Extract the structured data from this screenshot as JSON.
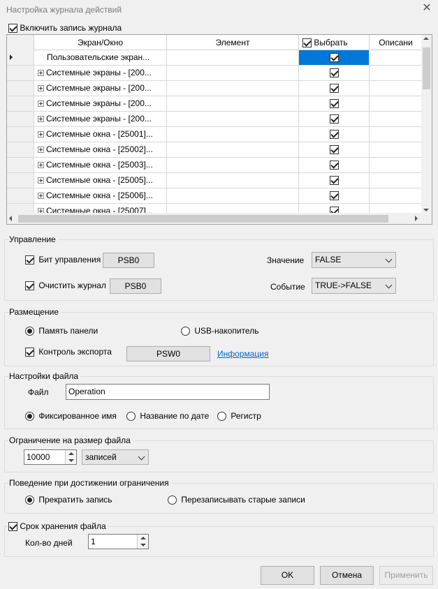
{
  "window": {
    "title": "Настройка журнала действий"
  },
  "enable_logging": {
    "label": "Включить запись журнала",
    "checked": true
  },
  "grid": {
    "columns": [
      "Экран/Окно",
      "Элемент",
      "Выбрать",
      "Описани"
    ],
    "rows": [
      {
        "name": "Пользовательские экран...",
        "expandable": false,
        "selected": true,
        "current": true
      },
      {
        "name": "Системные экраны - [200...",
        "expandable": true,
        "selected": true
      },
      {
        "name": "Системные экраны - [200...",
        "expandable": true,
        "selected": true
      },
      {
        "name": "Системные экраны - [200...",
        "expandable": true,
        "selected": true
      },
      {
        "name": "Системные экраны - [200...",
        "expandable": true,
        "selected": true
      },
      {
        "name": "Системные окна - [25001]...",
        "expandable": true,
        "selected": true
      },
      {
        "name": "Системные окна - [25002]...",
        "expandable": true,
        "selected": true
      },
      {
        "name": "Системные окна - [25003]...",
        "expandable": true,
        "selected": true
      },
      {
        "name": "Системные окна - [25005]...",
        "expandable": true,
        "selected": true
      },
      {
        "name": "Системные окна - [25006]...",
        "expandable": true,
        "selected": true
      },
      {
        "name": "Системные окна - [25007]...",
        "expandable": true,
        "selected": true
      }
    ]
  },
  "control": {
    "title": "Управление",
    "control_bit": {
      "label": "Бит управления",
      "checked": true,
      "address": "PSB0"
    },
    "clear_log": {
      "label": "Очистить журнал",
      "checked": true,
      "address": "PSB0"
    },
    "value": {
      "label": "Значение",
      "selected": "FALSE"
    },
    "event": {
      "label": "Событие",
      "selected": "TRUE->FALSE"
    }
  },
  "placement": {
    "title": "Размещение",
    "panel_memory": {
      "label": "Память панели",
      "selected": true
    },
    "usb": {
      "label": "USB-накопитель",
      "selected": false
    },
    "export_control": {
      "label": "Контроль экспорта",
      "checked": true,
      "address": "PSW0"
    },
    "info_link": "Информация"
  },
  "file_settings": {
    "title": "Настройки файла",
    "file_label": "Файл",
    "file_value": "Operation",
    "fixed_name": {
      "label": "Фиксированное имя",
      "selected": true
    },
    "date_name": {
      "label": "Название по дате",
      "selected": false
    },
    "register": {
      "label": "Регистр",
      "selected": false
    }
  },
  "size_limit": {
    "title": "Ограничение на размер файла",
    "value": "10000",
    "unit": "записей"
  },
  "limit_behavior": {
    "title": "Поведение при достижении ограничения",
    "stop": {
      "label": "Прекратить запись",
      "selected": true
    },
    "overwrite": {
      "label": "Перезаписывать старые записи",
      "selected": false
    }
  },
  "retention": {
    "label": "Срок хранения файла",
    "checked": true,
    "days_label": "Кол-во дней",
    "days_value": "1"
  },
  "buttons": {
    "ok": "OK",
    "cancel": "Отмена",
    "apply": "Применить"
  },
  "colors": {
    "accent": "#0078d7",
    "link": "#0066cc",
    "background": "#f0f0f0"
  }
}
